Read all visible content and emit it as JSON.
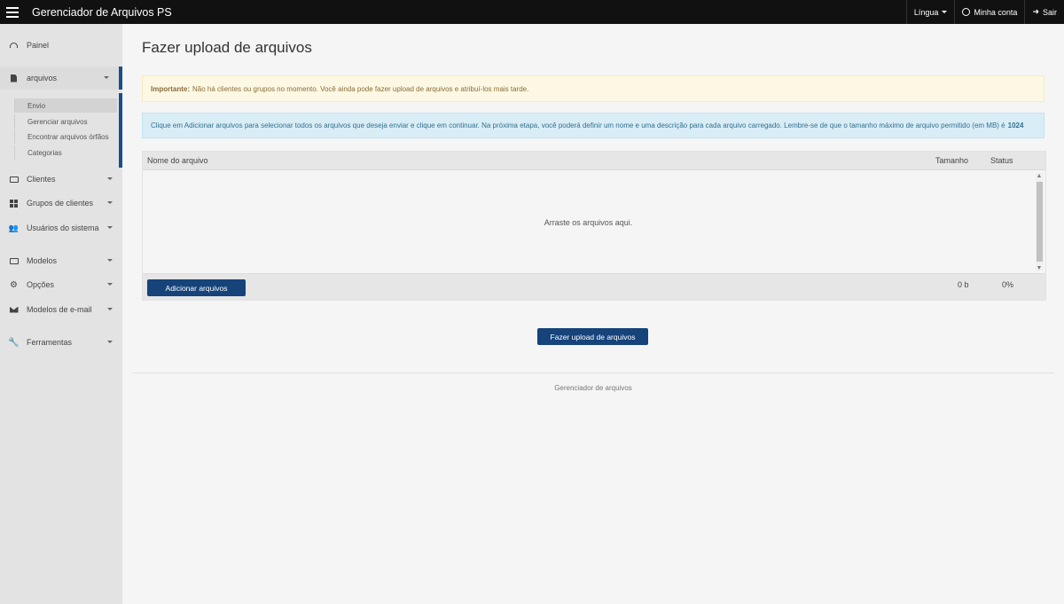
{
  "topbar": {
    "title": "Gerenciador de Arquivos PS",
    "language_label": "Língua",
    "account_label": "Minha conta",
    "logout_label": "Sair"
  },
  "sidebar": {
    "items": [
      {
        "label": "Painel",
        "icon": "dashboard-icon"
      },
      {
        "label": "arquivos",
        "icon": "file-icon"
      },
      {
        "label": "Clientes",
        "icon": "id-card-icon"
      },
      {
        "label": "Grupos de clientes",
        "icon": "grid-icon"
      },
      {
        "label": "Usuários do sistema",
        "icon": "users-icon"
      },
      {
        "label": "Modelos",
        "icon": "monitor-icon"
      },
      {
        "label": "Opções",
        "icon": "gear-icon"
      },
      {
        "label": "Modelos de e-mail",
        "icon": "envelope-icon"
      },
      {
        "label": "Ferramentas",
        "icon": "wrench-icon"
      }
    ],
    "submenu": [
      {
        "label": "Envio"
      },
      {
        "label": "Gerenciar arquivos"
      },
      {
        "label": "Encontrar arquivos órfãos"
      },
      {
        "label": "Categorias"
      }
    ]
  },
  "main": {
    "page_title": "Fazer upload de arquivos",
    "warning_strong": "Importante:",
    "warning_text": "Não há clientes ou grupos no momento. Você ainda pode fazer upload de arquivos e atribuí-los mais tarde.",
    "info_text": "Clique em Adicionar arquivos para selecionar todos os arquivos que deseja enviar e clique em continuar. Na próxima etapa, você poderá definir um nome e uma descrição para cada arquivo carregado. Lembre-se de que o tamanho máximo de arquivo permitido (em MB) é",
    "info_max": "1024",
    "uploader": {
      "col_name": "Nome do arquivo",
      "col_size": "Tamanho",
      "col_status": "Status",
      "drop_text": "Arraste os arquivos aqui.",
      "add_button": "Adicionar arquivos",
      "total_size": "0 b",
      "total_percent": "0%"
    },
    "upload_button": "Fazer upload de arquivos",
    "footer": "Gerenciador de arquivos"
  }
}
